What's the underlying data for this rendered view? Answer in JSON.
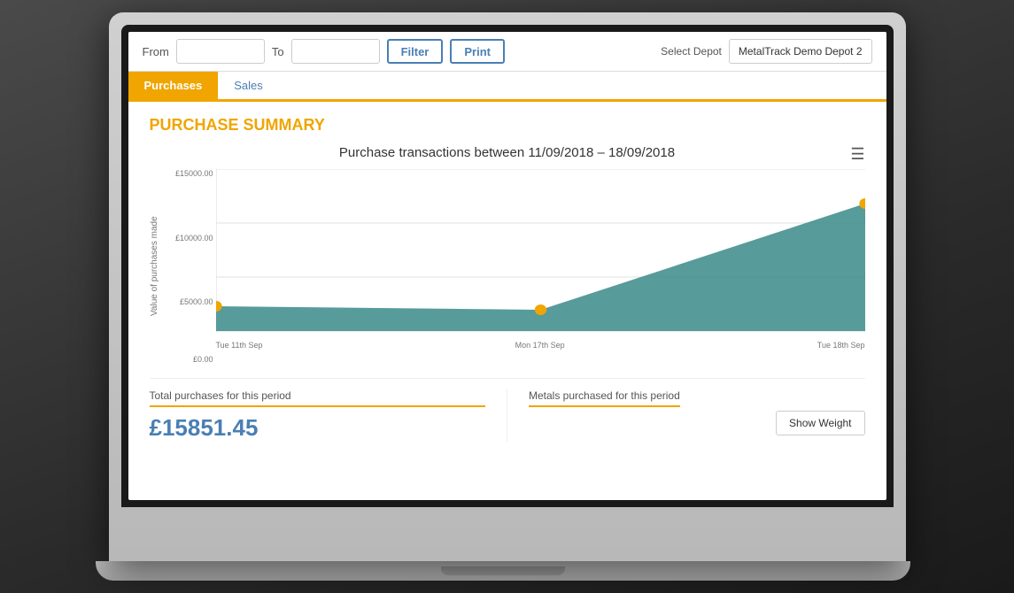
{
  "toolbar": {
    "from_label": "From",
    "to_label": "To",
    "from_value": "",
    "to_value": "",
    "filter_button": "Filter",
    "print_button": "Print",
    "depot_label": "Select Depot",
    "depot_value": "MetalTrack Demo Depot 2"
  },
  "tabs": [
    {
      "id": "purchases",
      "label": "Purchases",
      "active": true
    },
    {
      "id": "sales",
      "label": "Sales",
      "active": false
    }
  ],
  "purchase_summary": {
    "section_title": "PURCHASE SUMMARY",
    "chart_title": "Purchase transactions between 11/09/2018 – 18/09/2018",
    "y_axis_label": "Value of purchases made",
    "y_ticks": [
      {
        "label": "£15000.00",
        "pct": 0
      },
      {
        "label": "£10000.00",
        "pct": 33
      },
      {
        "label": "£5000.00",
        "pct": 66
      },
      {
        "label": "£0.00",
        "pct": 100
      }
    ],
    "x_labels": [
      "Tue 11th Sep",
      "Mon 17th Sep",
      "Tue 18th Sep"
    ],
    "total_label": "Total purchases for this period",
    "total_value": "£15851.45",
    "metals_label": "Metals purchased for this period",
    "show_weight_button": "Show Weight"
  },
  "colors": {
    "orange": "#f0a500",
    "blue": "#4a7fb5",
    "teal": "#3a8a8a",
    "chart_fill": "#3a8a8a"
  }
}
